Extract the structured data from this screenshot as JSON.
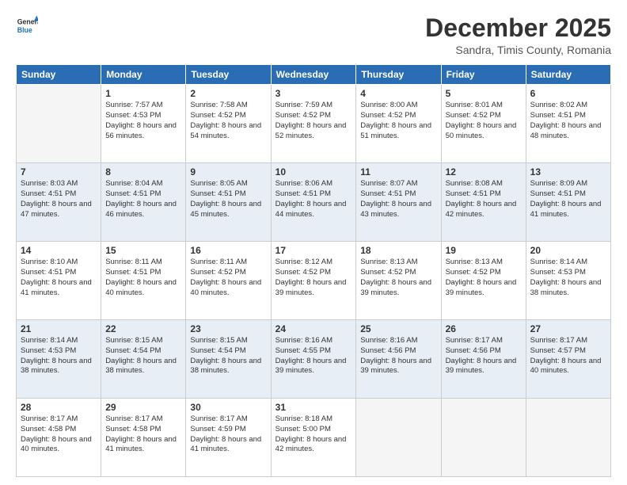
{
  "header": {
    "logo_general": "General",
    "logo_blue": "Blue",
    "month_title": "December 2025",
    "subtitle": "Sandra, Timis County, Romania"
  },
  "days_of_week": [
    "Sunday",
    "Monday",
    "Tuesday",
    "Wednesday",
    "Thursday",
    "Friday",
    "Saturday"
  ],
  "weeks": [
    [
      {
        "day": "",
        "empty": true
      },
      {
        "day": "1",
        "sunrise": "Sunrise: 7:57 AM",
        "sunset": "Sunset: 4:53 PM",
        "daylight": "Daylight: 8 hours and 56 minutes."
      },
      {
        "day": "2",
        "sunrise": "Sunrise: 7:58 AM",
        "sunset": "Sunset: 4:52 PM",
        "daylight": "Daylight: 8 hours and 54 minutes."
      },
      {
        "day": "3",
        "sunrise": "Sunrise: 7:59 AM",
        "sunset": "Sunset: 4:52 PM",
        "daylight": "Daylight: 8 hours and 52 minutes."
      },
      {
        "day": "4",
        "sunrise": "Sunrise: 8:00 AM",
        "sunset": "Sunset: 4:52 PM",
        "daylight": "Daylight: 8 hours and 51 minutes."
      },
      {
        "day": "5",
        "sunrise": "Sunrise: 8:01 AM",
        "sunset": "Sunset: 4:52 PM",
        "daylight": "Daylight: 8 hours and 50 minutes."
      },
      {
        "day": "6",
        "sunrise": "Sunrise: 8:02 AM",
        "sunset": "Sunset: 4:51 PM",
        "daylight": "Daylight: 8 hours and 48 minutes."
      }
    ],
    [
      {
        "day": "7",
        "sunrise": "Sunrise: 8:03 AM",
        "sunset": "Sunset: 4:51 PM",
        "daylight": "Daylight: 8 hours and 47 minutes."
      },
      {
        "day": "8",
        "sunrise": "Sunrise: 8:04 AM",
        "sunset": "Sunset: 4:51 PM",
        "daylight": "Daylight: 8 hours and 46 minutes."
      },
      {
        "day": "9",
        "sunrise": "Sunrise: 8:05 AM",
        "sunset": "Sunset: 4:51 PM",
        "daylight": "Daylight: 8 hours and 45 minutes."
      },
      {
        "day": "10",
        "sunrise": "Sunrise: 8:06 AM",
        "sunset": "Sunset: 4:51 PM",
        "daylight": "Daylight: 8 hours and 44 minutes."
      },
      {
        "day": "11",
        "sunrise": "Sunrise: 8:07 AM",
        "sunset": "Sunset: 4:51 PM",
        "daylight": "Daylight: 8 hours and 43 minutes."
      },
      {
        "day": "12",
        "sunrise": "Sunrise: 8:08 AM",
        "sunset": "Sunset: 4:51 PM",
        "daylight": "Daylight: 8 hours and 42 minutes."
      },
      {
        "day": "13",
        "sunrise": "Sunrise: 8:09 AM",
        "sunset": "Sunset: 4:51 PM",
        "daylight": "Daylight: 8 hours and 41 minutes."
      }
    ],
    [
      {
        "day": "14",
        "sunrise": "Sunrise: 8:10 AM",
        "sunset": "Sunset: 4:51 PM",
        "daylight": "Daylight: 8 hours and 41 minutes."
      },
      {
        "day": "15",
        "sunrise": "Sunrise: 8:11 AM",
        "sunset": "Sunset: 4:51 PM",
        "daylight": "Daylight: 8 hours and 40 minutes."
      },
      {
        "day": "16",
        "sunrise": "Sunrise: 8:11 AM",
        "sunset": "Sunset: 4:52 PM",
        "daylight": "Daylight: 8 hours and 40 minutes."
      },
      {
        "day": "17",
        "sunrise": "Sunrise: 8:12 AM",
        "sunset": "Sunset: 4:52 PM",
        "daylight": "Daylight: 8 hours and 39 minutes."
      },
      {
        "day": "18",
        "sunrise": "Sunrise: 8:13 AM",
        "sunset": "Sunset: 4:52 PM",
        "daylight": "Daylight: 8 hours and 39 minutes."
      },
      {
        "day": "19",
        "sunrise": "Sunrise: 8:13 AM",
        "sunset": "Sunset: 4:52 PM",
        "daylight": "Daylight: 8 hours and 39 minutes."
      },
      {
        "day": "20",
        "sunrise": "Sunrise: 8:14 AM",
        "sunset": "Sunset: 4:53 PM",
        "daylight": "Daylight: 8 hours and 38 minutes."
      }
    ],
    [
      {
        "day": "21",
        "sunrise": "Sunrise: 8:14 AM",
        "sunset": "Sunset: 4:53 PM",
        "daylight": "Daylight: 8 hours and 38 minutes."
      },
      {
        "day": "22",
        "sunrise": "Sunrise: 8:15 AM",
        "sunset": "Sunset: 4:54 PM",
        "daylight": "Daylight: 8 hours and 38 minutes."
      },
      {
        "day": "23",
        "sunrise": "Sunrise: 8:15 AM",
        "sunset": "Sunset: 4:54 PM",
        "daylight": "Daylight: 8 hours and 38 minutes."
      },
      {
        "day": "24",
        "sunrise": "Sunrise: 8:16 AM",
        "sunset": "Sunset: 4:55 PM",
        "daylight": "Daylight: 8 hours and 39 minutes."
      },
      {
        "day": "25",
        "sunrise": "Sunrise: 8:16 AM",
        "sunset": "Sunset: 4:56 PM",
        "daylight": "Daylight: 8 hours and 39 minutes."
      },
      {
        "day": "26",
        "sunrise": "Sunrise: 8:17 AM",
        "sunset": "Sunset: 4:56 PM",
        "daylight": "Daylight: 8 hours and 39 minutes."
      },
      {
        "day": "27",
        "sunrise": "Sunrise: 8:17 AM",
        "sunset": "Sunset: 4:57 PM",
        "daylight": "Daylight: 8 hours and 40 minutes."
      }
    ],
    [
      {
        "day": "28",
        "sunrise": "Sunrise: 8:17 AM",
        "sunset": "Sunset: 4:58 PM",
        "daylight": "Daylight: 8 hours and 40 minutes."
      },
      {
        "day": "29",
        "sunrise": "Sunrise: 8:17 AM",
        "sunset": "Sunset: 4:58 PM",
        "daylight": "Daylight: 8 hours and 41 minutes."
      },
      {
        "day": "30",
        "sunrise": "Sunrise: 8:17 AM",
        "sunset": "Sunset: 4:59 PM",
        "daylight": "Daylight: 8 hours and 41 minutes."
      },
      {
        "day": "31",
        "sunrise": "Sunrise: 8:18 AM",
        "sunset": "Sunset: 5:00 PM",
        "daylight": "Daylight: 8 hours and 42 minutes."
      },
      {
        "day": "",
        "empty": true
      },
      {
        "day": "",
        "empty": true
      },
      {
        "day": "",
        "empty": true
      }
    ]
  ]
}
